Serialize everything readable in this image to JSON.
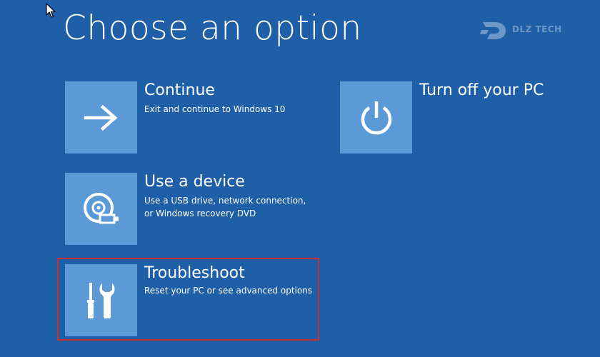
{
  "page": {
    "title": "Choose an option"
  },
  "watermark": {
    "text": "DLZ TECH"
  },
  "options": [
    {
      "id": "continue",
      "title": "Continue",
      "description": [
        "Exit and continue to Windows 10"
      ],
      "icon": "arrow-right-icon"
    },
    {
      "id": "use-device",
      "title": "Use a device",
      "description": [
        "Use a USB drive, network connection,",
        "or Windows recovery DVD"
      ],
      "icon": "disc-drive-icon"
    },
    {
      "id": "troubleshoot",
      "title": "Troubleshoot",
      "description": [
        "Reset your PC or see advanced options"
      ],
      "icon": "tools-icon",
      "highlighted": true
    },
    {
      "id": "turn-off",
      "title": "Turn off your PC",
      "description": [],
      "icon": "power-icon"
    }
  ],
  "colors": {
    "background": "#1f5fa8",
    "tile": "#5b9ad6",
    "highlight": "#c8312d",
    "text": "#ffffff"
  }
}
